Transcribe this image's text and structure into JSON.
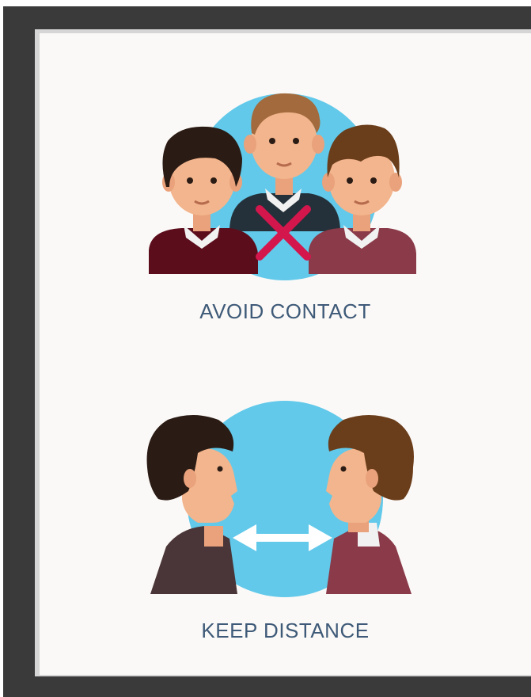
{
  "poster": {
    "section_1": {
      "label": "AVOID CONTACT"
    },
    "section_2": {
      "label": "KEEP DISTANCE"
    }
  },
  "colors": {
    "frame": "#3a3a3a",
    "paper": "#fbf9f7",
    "circle": "#62c9ea",
    "label_text": "#3e5a78",
    "cross": "#d3174d",
    "arrow": "#ffffff"
  },
  "icons": [
    "three-people-illustration",
    "cross-icon",
    "two-faces-illustration",
    "double-arrow-icon"
  ]
}
